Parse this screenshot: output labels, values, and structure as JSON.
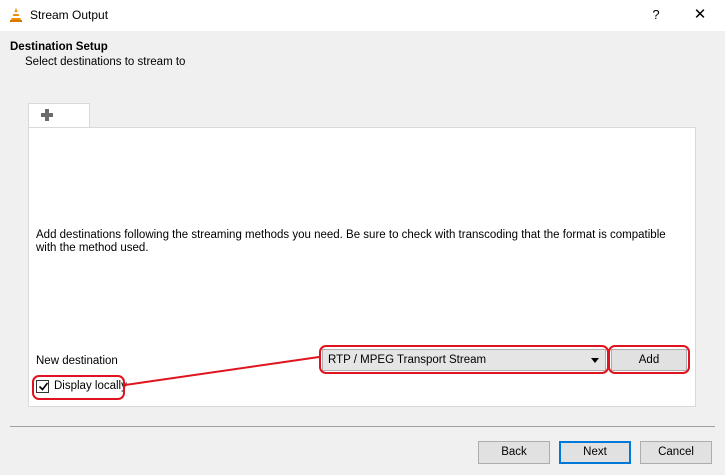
{
  "window": {
    "title": "Stream Output",
    "help_label": "?",
    "close_label": "✕"
  },
  "header": {
    "title": "Destination Setup",
    "subtitle": "Select destinations to stream to"
  },
  "tabs": [
    {
      "icon": "plus-icon"
    }
  ],
  "panel": {
    "description": "Add destinations following the streaming methods you need. Be sure to check with transcoding that the format is compatible with the method used.",
    "new_destination_label": "New destination",
    "destination_select_value": "RTP / MPEG Transport Stream",
    "add_button": "Add",
    "display_locally_label": "Display locally",
    "display_locally_checked": true
  },
  "footer": {
    "back": "Back",
    "next": "Next",
    "cancel": "Cancel"
  },
  "colors": {
    "highlight": "#e0141e",
    "accent": "#0078d7",
    "vlc_orange": "#f08c00"
  }
}
